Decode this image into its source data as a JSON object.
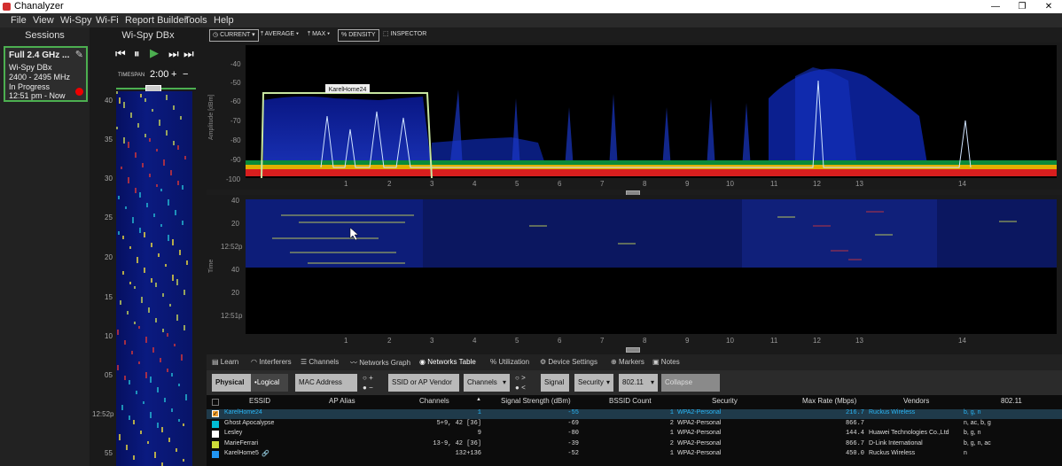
{
  "window": {
    "title": "Chanalyzer",
    "min": "—",
    "restore": "❐",
    "close": "✕"
  },
  "menu": [
    "File",
    "View",
    "Wi-Spy",
    "Wi-Fi",
    "Report Builder",
    "Tools",
    "Help"
  ],
  "sessions": {
    "title": "Sessions",
    "card": {
      "name": "Full 2.4 GHz ...",
      "device": "Wi-Spy DBx",
      "range": "2400 - 2495 MHz",
      "status": "In Progress",
      "time": "12:51 pm - Now"
    }
  },
  "wispy": {
    "title": "Wi-Spy DBx",
    "timespan_label": "TIMESPAN",
    "timespan_value": "2:00",
    "plus": "+",
    "minus": "−",
    "ticks": [
      "40",
      "35",
      "30",
      "25",
      "20",
      "15",
      "10",
      "05",
      "12:52p",
      "55"
    ]
  },
  "toolbar": {
    "current": "CURRENT",
    "average": "AVERAGE",
    "max": "MAX",
    "density": "DENSITY",
    "inspector": "INSPECTOR"
  },
  "spectrum": {
    "ylabel": "Amplitude [dBm]",
    "yticks": [
      "-40",
      "-50",
      "-60",
      "-70",
      "-80",
      "-90",
      "-100"
    ],
    "xticks": [
      "1",
      "2",
      "3",
      "4",
      "5",
      "6",
      "7",
      "8",
      "9",
      "10",
      "11",
      "12",
      "13",
      "14"
    ],
    "highlight_label": "KarelHome24"
  },
  "waterfall": {
    "ylabel": "Time",
    "yticks": [
      "40",
      "20",
      "12:52p",
      "40",
      "20",
      "12:51p"
    ],
    "xticks": [
      "1",
      "2",
      "3",
      "4",
      "5",
      "6",
      "7",
      "8",
      "9",
      "10",
      "11",
      "12",
      "13",
      "14"
    ]
  },
  "tabs": [
    "Learn",
    "Interferers",
    "Channels",
    "Networks Graph",
    "Networks Table",
    "Utilization",
    "Device Settings",
    "Markers",
    "Notes"
  ],
  "filters": {
    "physical": "Physical",
    "logical": "Logical",
    "mac": "MAC Address",
    "plus": "+",
    "minus": "−",
    "ssid": "SSID or AP Vendor",
    "channels": "Channels",
    "gt": ">",
    "lt": "<",
    "signal": "Signal",
    "security": "Security",
    "std": "802.11",
    "collapse": "Collapse"
  },
  "table": {
    "headers": [
      "ESSID",
      "AP Alias",
      "Channels",
      "Signal Strength (dBm)",
      "BSSID Count",
      "Security",
      "Max Rate (Mbps)",
      "Vendors",
      "802.11"
    ],
    "rows": [
      {
        "essid": "KarelHome24",
        "alias": "",
        "channels": "1",
        "signal": "-55",
        "bssid": "1",
        "security": "WPA2-Personal",
        "rate": "216.7",
        "vendor": "Ruckus Wireless",
        "std": "b, g, n",
        "color": "#ffffff",
        "checked": true
      },
      {
        "essid": "Ghost Apocalypse",
        "alias": "",
        "channels": "5+9, 42 [36]",
        "signal": "-69",
        "bssid": "2",
        "security": "WPA2-Personal",
        "rate": "866.7",
        "vendor": "",
        "std": "n, ac, b, g",
        "color": "#00bcd4",
        "checked": false
      },
      {
        "essid": "Lesley",
        "alias": "",
        "channels": "9",
        "signal": "-80",
        "bssid": "1",
        "security": "WPA2-Personal",
        "rate": "144.4",
        "vendor": "Huawei Technologies Co.,Ltd",
        "std": "b, g, n",
        "color": "#ffffff",
        "checked": false
      },
      {
        "essid": "MarieFerrari",
        "alias": "",
        "channels": "13-9, 42 [36]",
        "signal": "-39",
        "bssid": "2",
        "security": "WPA2-Personal",
        "rate": "866.7",
        "vendor": "D-Link International",
        "std": "b, g, n, ac",
        "color": "#cddc39",
        "checked": false
      },
      {
        "essid": "KarelHome5",
        "alias": "",
        "channels": "132+136",
        "signal": "-52",
        "bssid": "1",
        "security": "WPA2-Personal",
        "rate": "450.0",
        "vendor": "Ruckus Wireless",
        "std": "n",
        "color": "#2196f3",
        "checked": false
      }
    ]
  },
  "colors": {
    "accent": "#4caf50",
    "selected": "#29b6f6",
    "row_selected_bg": "#1f3a4a"
  }
}
